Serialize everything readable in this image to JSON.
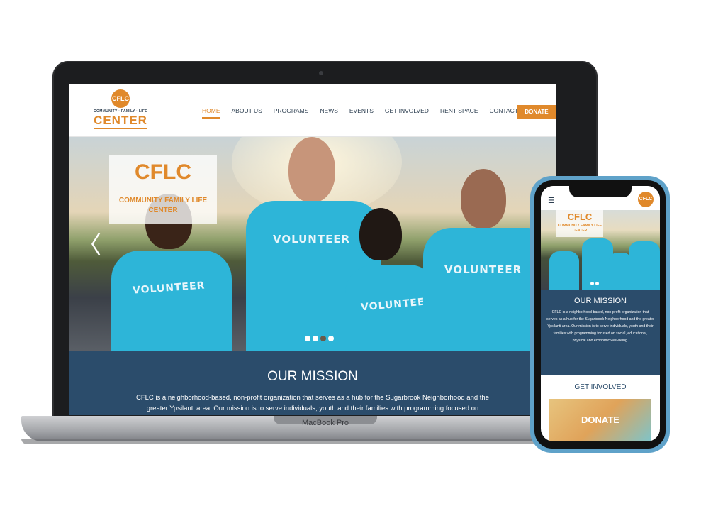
{
  "device_labels": {
    "laptop_brand": "MacBook Pro"
  },
  "site": {
    "logo": {
      "badge": "CFLC",
      "tagline": "COMMUNITY · FAMILY · LIFE",
      "name": "CENTER"
    },
    "nav": [
      {
        "label": "HOME",
        "active": true
      },
      {
        "label": "ABOUT US",
        "active": false
      },
      {
        "label": "PROGRAMS",
        "active": false
      },
      {
        "label": "NEWS",
        "active": false
      },
      {
        "label": "EVENTS",
        "active": false
      },
      {
        "label": "GET INVOLVED",
        "active": false
      },
      {
        "label": "RENT SPACE",
        "active": false
      },
      {
        "label": "CONTACT US",
        "active": false
      }
    ],
    "donate_label": "DONATE",
    "hero": {
      "title": "CFLC",
      "subtitle": "COMMUNITY FAMILY LIFE CENTER",
      "shirt_text": "VOLUNTEER",
      "slides": 4,
      "active_slide": 3,
      "prev_glyph": "〈"
    },
    "mission": {
      "title": "OUR MISSION",
      "text": "CFLC is a neighborhood-based, non-profit organization that serves as a hub for the Sugarbrook Neighborhood and the greater Ypsilanti area. Our mission is to serve individuals, youth and their families with programming focused on"
    }
  },
  "phone": {
    "menu_icon": "☰",
    "logo_badge": "CFLC",
    "hero_title": "CFLC",
    "hero_subtitle": "COMMUNITY FAMILY LIFE CENTER",
    "mission_title": "OUR MISSION",
    "mission_text": "CFLC is a neighborhood-based, non-profit organization that serves as a hub for the Sugarbrook Neighborhood and the greater Ypsilanti area. Our mission is to serve individuals, youth and their families with programming focused on social, educational, physical and economic well-being.",
    "get_involved": "GET INVOLVED",
    "donate": "DONATE"
  },
  "colors": {
    "accent": "#e0892b",
    "navy": "#2b4c6b",
    "shirt": "#2db5d8"
  }
}
